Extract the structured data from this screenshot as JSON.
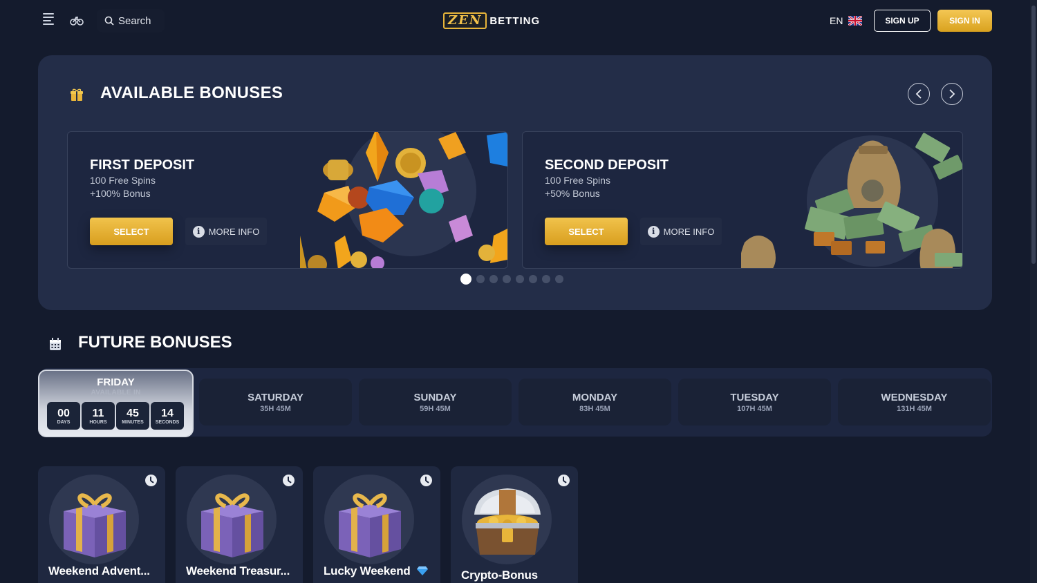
{
  "header": {
    "search_label": "Search",
    "logo_mark": "ZEN",
    "logo_text": "BETTING",
    "language": "EN",
    "signup_label": "SIGN UP",
    "signin_label": "SIGN IN"
  },
  "available": {
    "title": "AVAILABLE BONUSES",
    "cards": [
      {
        "title": "FIRST DEPOSIT",
        "line1": "100 Free Spins",
        "line2": "+100% Bonus",
        "select_label": "SELECT",
        "more_label": "MORE INFO"
      },
      {
        "title": "SECOND DEPOSIT",
        "line1": "100 Free Spins",
        "line2": "+50% Bonus",
        "select_label": "SELECT",
        "more_label": "MORE INFO"
      }
    ],
    "carousel_pages": 8,
    "carousel_active": 1
  },
  "future": {
    "title": "FUTURE BONUSES",
    "active_day": {
      "name": "FRIDAY",
      "subtitle": "AVAILABLE IN",
      "countdown": [
        {
          "value": "00",
          "label": "DAYS"
        },
        {
          "value": "11",
          "label": "HOURS"
        },
        {
          "value": "45",
          "label": "MINUTES"
        },
        {
          "value": "14",
          "label": "SECONDS"
        }
      ]
    },
    "days": [
      {
        "name": "SATURDAY",
        "time": "35H 45M"
      },
      {
        "name": "SUNDAY",
        "time": "59H 45M"
      },
      {
        "name": "MONDAY",
        "time": "83H 45M"
      },
      {
        "name": "TUESDAY",
        "time": "107H 45M"
      },
      {
        "name": "WEDNESDAY",
        "time": "131H 45M"
      }
    ]
  },
  "tiles": [
    {
      "name": "Weekend Advent...",
      "art": "gift-box-icon"
    },
    {
      "name": "Weekend Treasur...",
      "art": "gift-box-icon"
    },
    {
      "name": "Lucky Weekend",
      "art": "gift-box-icon",
      "badge": "diamond-icon"
    },
    {
      "name": "Crypto-Bonus",
      "art": "treasure-chest-icon"
    }
  ],
  "colors": {
    "background": "#141b2d",
    "panel": "#232d48",
    "accent_gold": "#e8b53a"
  }
}
